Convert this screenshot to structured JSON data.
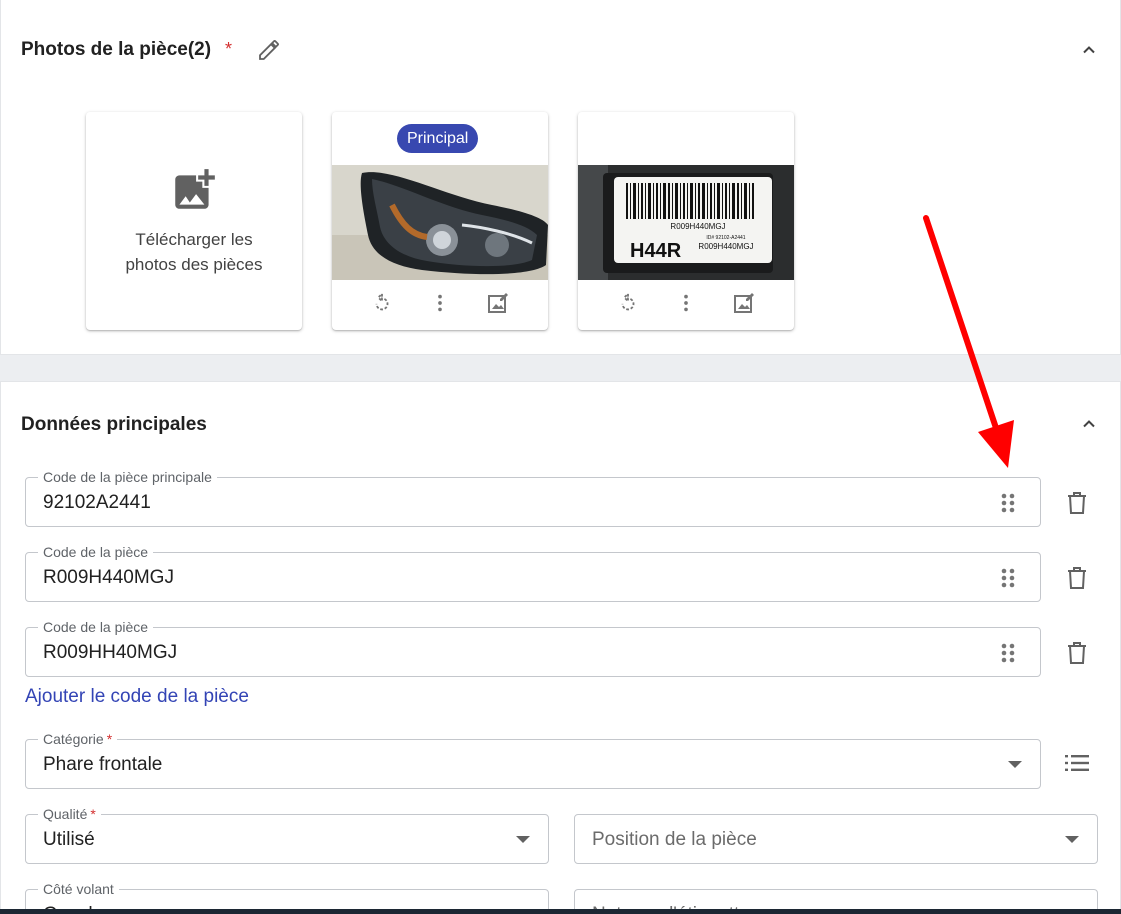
{
  "photos_section": {
    "title": "Photos de la pièce(2)",
    "required_mark": "*",
    "upload_label": "Télécharger les photos des pièces",
    "principal_badge": "Principal",
    "label_image_texts": {
      "code_top": "R009H440MGJ",
      "code_small": "ID# 92102-A2441",
      "big_code": "H44R",
      "code_bottom": "R009H440MGJ"
    },
    "icons": [
      "edit-pencil-icon",
      "chevron-up-icon",
      "add-photo-icon",
      "rotate-icon",
      "more-vert-icon",
      "edit-image-icon"
    ]
  },
  "main_section": {
    "title": "Données principales",
    "part_codes": [
      {
        "label": "Code de la pièce principale",
        "value": "92102A2441"
      },
      {
        "label": "Code de la pièce",
        "value": "R009H440MGJ"
      },
      {
        "label": "Code de la pièce",
        "value": "R009HH40MGJ"
      }
    ],
    "add_code_link": "Ajouter le code de la pièce",
    "category": {
      "label": "Catégorie",
      "required_mark": "*",
      "value": "Phare frontale"
    },
    "quality": {
      "label": "Qualité",
      "required_mark": "*",
      "value": "Utilisé"
    },
    "position": {
      "placeholder": "Position de la pièce"
    },
    "steering_side": {
      "label": "Côté volant",
      "value": "Gauche"
    },
    "label_note": {
      "placeholder": "Note sur l'étiquette"
    }
  },
  "colors": {
    "accent": "#3848b0",
    "link": "#3344b5",
    "required": "#d32f2f",
    "annotation_arrow": "#ff0000"
  }
}
